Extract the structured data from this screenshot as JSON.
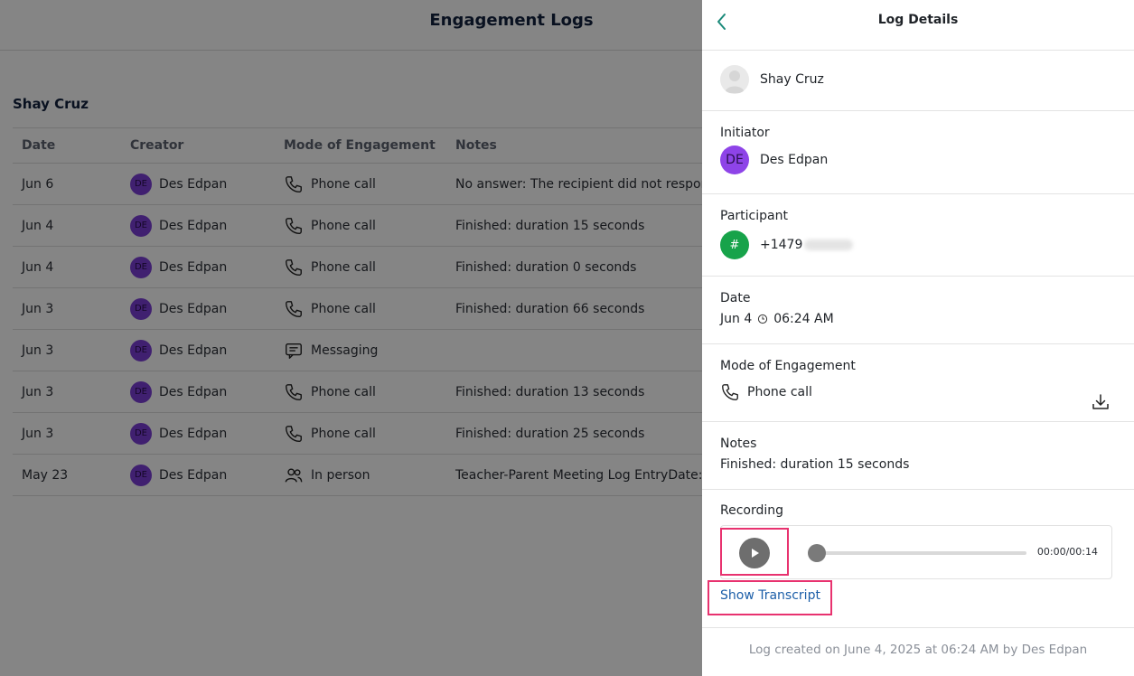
{
  "page": {
    "title": "Engagement Logs",
    "student_name": "Shay Cruz",
    "columns": [
      "Date",
      "Creator",
      "Mode of Engagement",
      "Notes"
    ],
    "rows": [
      {
        "date": "Jun 6",
        "creator_initials": "DE",
        "creator": "Des Edpan",
        "mode_icon": "phone-icon",
        "mode": "Phone call",
        "notes": "No answer: The recipient did not respond"
      },
      {
        "date": "Jun 4",
        "creator_initials": "DE",
        "creator": "Des Edpan",
        "mode_icon": "phone-icon",
        "mode": "Phone call",
        "notes": "Finished: duration 15 seconds"
      },
      {
        "date": "Jun 4",
        "creator_initials": "DE",
        "creator": "Des Edpan",
        "mode_icon": "phone-icon",
        "mode": "Phone call",
        "notes": "Finished: duration 0 seconds"
      },
      {
        "date": "Jun 3",
        "creator_initials": "DE",
        "creator": "Des Edpan",
        "mode_icon": "phone-icon",
        "mode": "Phone call",
        "notes": "Finished: duration 66 seconds"
      },
      {
        "date": "Jun 3",
        "creator_initials": "DE",
        "creator": "Des Edpan",
        "mode_icon": "message-icon",
        "mode": "Messaging",
        "notes": ""
      },
      {
        "date": "Jun 3",
        "creator_initials": "DE",
        "creator": "Des Edpan",
        "mode_icon": "phone-icon",
        "mode": "Phone call",
        "notes": "Finished: duration 13 seconds"
      },
      {
        "date": "Jun 3",
        "creator_initials": "DE",
        "creator": "Des Edpan",
        "mode_icon": "phone-icon",
        "mode": "Phone call",
        "notes": "Finished: duration 25 seconds"
      },
      {
        "date": "May 23",
        "creator_initials": "DE",
        "creator": "Des Edpan",
        "mode_icon": "people-icon",
        "mode": "In person",
        "notes": "Teacher-Parent Meeting Log EntryDate: J"
      }
    ]
  },
  "drawer": {
    "title": "Log Details",
    "student": "Shay Cruz",
    "initiator": {
      "label": "Initiator",
      "initials": "DE",
      "name": "Des Edpan"
    },
    "participant": {
      "label": "Participant",
      "badge": "#",
      "phone_prefix": "+1479"
    },
    "date": {
      "label": "Date",
      "day": "Jun 4",
      "time": "06:24 AM"
    },
    "mode": {
      "label": "Mode of Engagement",
      "value": "Phone call"
    },
    "notes": {
      "label": "Notes",
      "value": "Finished: duration 15 seconds"
    },
    "recording": {
      "label": "Recording",
      "time": "00:00/00:14",
      "progress": 0
    },
    "transcript_link": "Show Transcript",
    "footer": "Log created on June 4, 2025 at 06:24 AM by Des Edpan"
  },
  "colors": {
    "accent": "#e8326f",
    "link": "#1b5ea8",
    "initiator": "#8e44e8",
    "participant": "#17a34a"
  }
}
